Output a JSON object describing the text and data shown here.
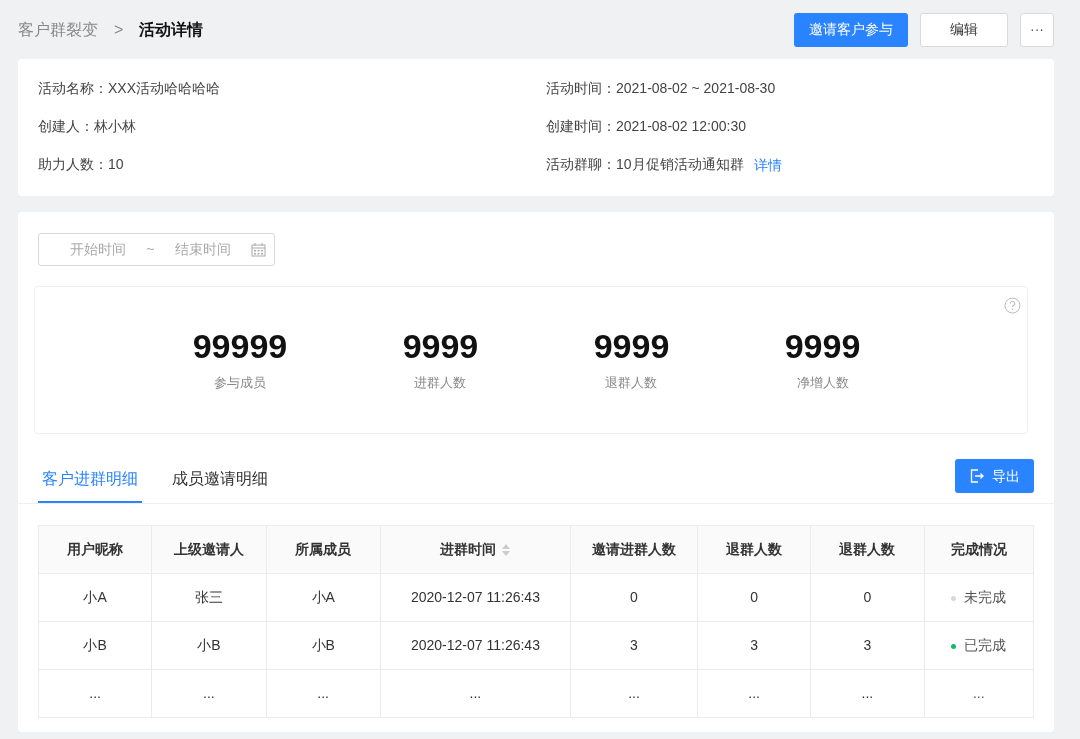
{
  "breadcrumb": {
    "parent": "客户群裂变",
    "separator": ">",
    "current": "活动详情"
  },
  "actions": {
    "primary": "邀请客户参与",
    "secondary": "编辑",
    "more": "···"
  },
  "info": [
    {
      "label": "活动名称：",
      "value": "XXX活动哈哈哈哈"
    },
    {
      "label": "活动时间：",
      "value": "2021-08-02 ~ 2021-08-30"
    },
    {
      "label": "创建人：",
      "value": "林小林"
    },
    {
      "label": "创建时间：",
      "value": "2021-08-02  12:00:30"
    },
    {
      "label": "助力人数：",
      "value": "10"
    },
    {
      "label": "活动群聊：",
      "value": "10月促销活动通知群",
      "link": "详情"
    }
  ],
  "date_range": {
    "start_placeholder": "开始时间",
    "separator": "~",
    "end_placeholder": "结束时间"
  },
  "stats": [
    {
      "value": "99999",
      "label": "参与成员"
    },
    {
      "value": "9999",
      "label": "进群人数"
    },
    {
      "value": "9999",
      "label": "退群人数"
    },
    {
      "value": "9999",
      "label": "净增人数"
    }
  ],
  "tabs": [
    {
      "label": "客户进群明细",
      "selected": true
    },
    {
      "label": "成员邀请明细",
      "selected": false
    }
  ],
  "export_button": "导出",
  "table": {
    "columns": [
      {
        "label": "用户昵称",
        "sortable": false
      },
      {
        "label": "上级邀请人",
        "sortable": false
      },
      {
        "label": "所属成员",
        "sortable": false
      },
      {
        "label": "进群时间",
        "sortable": true
      },
      {
        "label": "邀请进群人数",
        "sortable": false
      },
      {
        "label": "退群人数",
        "sortable": false
      },
      {
        "label": "退群人数",
        "sortable": false
      },
      {
        "label": "完成情况",
        "sortable": false
      }
    ],
    "rows": [
      {
        "cells": [
          "小A",
          "张三",
          "小A",
          "2020-12-07  11:26:43",
          "0",
          "0",
          "0"
        ],
        "status": {
          "text": "未完成",
          "color": "#d9d9d9"
        }
      },
      {
        "cells": [
          "小B",
          "小B",
          "小B",
          "2020-12-07  11:26:43",
          "3",
          "3",
          "3"
        ],
        "status": {
          "text": "已完成",
          "color": "#14b866"
        }
      },
      {
        "cells": [
          "...",
          "...",
          "...",
          "...",
          "...",
          "...",
          "..."
        ],
        "status": {
          "text": "..."
        }
      }
    ]
  }
}
